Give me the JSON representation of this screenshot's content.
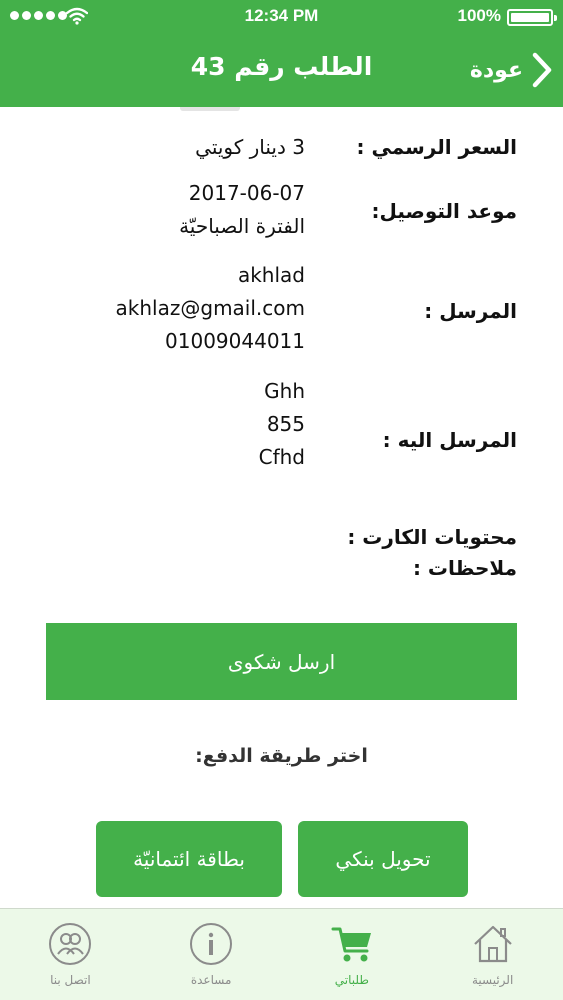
{
  "status_bar": {
    "time": "12:34 PM",
    "battery": "100%"
  },
  "header": {
    "title": "الطلب رقم 43",
    "back_label": "عودة",
    "back_icon": "chevron-right-icon"
  },
  "order": {
    "price": {
      "label": "السعر الرسمي :",
      "value": "3 دينار كويتي"
    },
    "delivery": {
      "label": "موعد التوصيل:",
      "date": "2017-06-07",
      "period": "الفترة الصباحيّة"
    },
    "sender": {
      "label": "المرسل :",
      "name": "akhlad",
      "email": "akhlaz@gmail.com",
      "phone": "01009044011"
    },
    "recipient": {
      "label": "المرسل اليه :",
      "line1": "Ghh",
      "line2": "855",
      "line3": "Cfhd"
    },
    "cart_contents_label": "محتويات الكارت :",
    "notes_label": "ملاحظات :"
  },
  "actions": {
    "complaint_button": "ارسل شكوى",
    "payment_label": "اختر طريقة الدفع:",
    "bank_transfer_button": "تحويل بنكي",
    "credit_card_button": "بطاقة ائتمانيّة"
  },
  "tabbar": {
    "home": "الرئيسية",
    "orders": "طلباتي",
    "help": "مساعدة",
    "contact": "اتصل بنا"
  },
  "colors": {
    "brand_green": "#44b04a",
    "background": "#ecf9e8",
    "tab_inactive": "#8b8b8b"
  }
}
